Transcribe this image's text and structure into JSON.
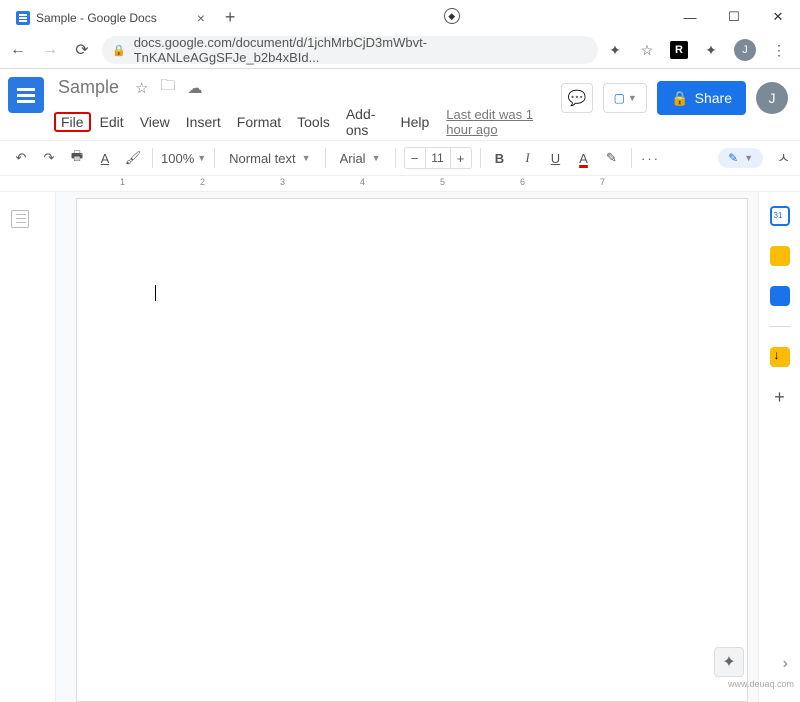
{
  "browser": {
    "tab_title": "Sample - Google Docs",
    "url": "docs.google.com/document/d/1jchMrbCjD3mWbvt-TnKANLeAGgSFJe_b2b4xBId...",
    "avatar_initial": "J"
  },
  "docs": {
    "title": "Sample",
    "menu": {
      "file": "File",
      "edit": "Edit",
      "view": "View",
      "insert": "Insert",
      "format": "Format",
      "tools": "Tools",
      "addons": "Add-ons",
      "help": "Help"
    },
    "last_edit": "Last edit was 1 hour ago",
    "share": "Share",
    "avatar_initial": "J"
  },
  "toolbar": {
    "zoom": "100%",
    "style": "Normal text",
    "font": "Arial",
    "font_size": "11",
    "minus": "−",
    "plus": "+",
    "bold": "B",
    "italic": "I",
    "underline": "U",
    "textcolor": "A",
    "more": "···"
  },
  "ruler": {
    "marks": [
      "1",
      "2",
      "3",
      "4",
      "5",
      "6",
      "7"
    ]
  },
  "watermark": "www.deuaq.com"
}
